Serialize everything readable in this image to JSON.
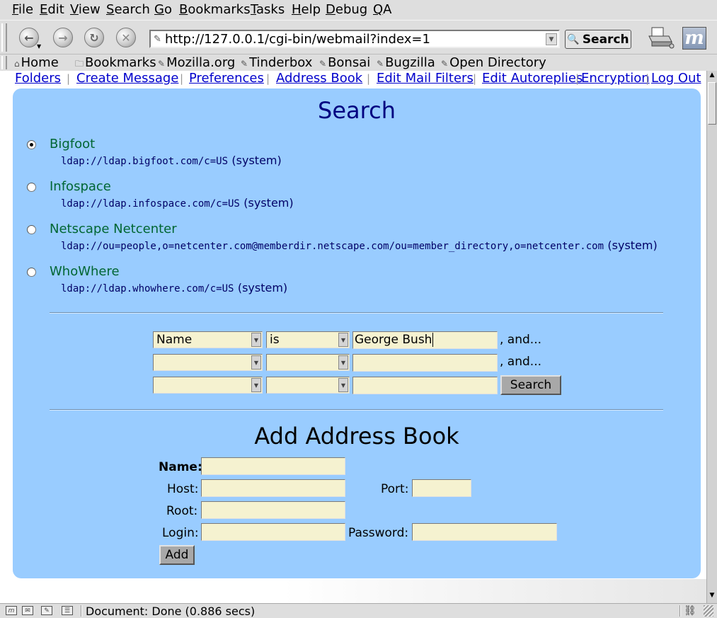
{
  "menu": [
    "File",
    "Edit",
    "View",
    "Search",
    "Go",
    "Bookmarks",
    "Tasks",
    "Help",
    "Debug",
    "QA"
  ],
  "navigation": {
    "url": "http://127.0.0.1/cgi-bin/webmail?index=1",
    "search_label": "Search",
    "back_icon": "back-arrow-icon",
    "forward_icon": "forward-arrow-icon",
    "reload_icon": "reload-icon",
    "stop_icon": "stop-icon"
  },
  "personal_toolbar": {
    "home": "Home",
    "bookmarks": "Bookmarks",
    "items": [
      "Mozilla.org",
      "Tinderbox",
      "Bonsai",
      "Bugzilla",
      "Open Directory"
    ]
  },
  "webmail_links": [
    "Folders",
    "Create Message",
    "Preferences",
    "Address Book",
    "Edit Mail Filters",
    "Edit Autoreplies",
    "Encryption",
    "Log Out"
  ],
  "search": {
    "title": "Search",
    "servers": [
      {
        "name": "Bigfoot",
        "url": "ldap://ldap.bigfoot.com/c=US",
        "scope": "(system)",
        "selected": true
      },
      {
        "name": "Infospace",
        "url": "ldap://ldap.infospace.com/c=US",
        "scope": "(system)",
        "selected": false
      },
      {
        "name": "Netscape Netcenter",
        "url": "ldap://ou=people,o=netcenter.com@memberdir.netscape.com/ou=member_directory,o=netcenter.com",
        "scope": "(system)",
        "selected": false
      },
      {
        "name": "WhoWhere",
        "url": "ldap://ldap.whowhere.com/c=US",
        "scope": "(system)",
        "selected": false
      }
    ],
    "criteria": [
      {
        "field": "Name",
        "op": "is",
        "value": "George Bush",
        "suffix": ", and..."
      },
      {
        "field": "",
        "op": "",
        "value": "",
        "suffix": ", and..."
      },
      {
        "field": "",
        "op": "",
        "value": "",
        "suffix": ""
      }
    ],
    "button": "Search"
  },
  "add_book": {
    "title": "Add Address Book",
    "name_label": "Name:",
    "host_label": "Host:",
    "port_label": "Port:",
    "root_label": "Root:",
    "login_label": "Login:",
    "password_label": "Password:",
    "add_button": "Add"
  },
  "status": {
    "text": "Document: Done (0.886 secs)"
  }
}
